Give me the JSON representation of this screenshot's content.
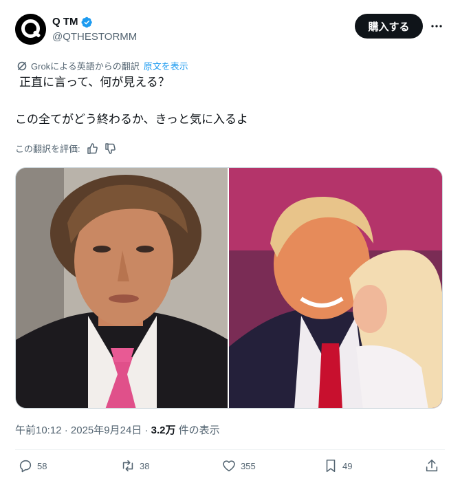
{
  "author": {
    "display_name": "Q TM",
    "handle": "@QTHESTORMM",
    "avatar_letter": "Q",
    "verified": true
  },
  "header": {
    "buy_label": "購入する",
    "more_label": "···"
  },
  "translation": {
    "label": "Grokによる英語からの翻訳",
    "show_original": "原文を表示"
  },
  "tweet": {
    "line1": "正直に言って、何が見える？",
    "line2": "この全てがどう終わるか、きっと気に入るよ"
  },
  "rating": {
    "label": "この翻訳を評価:"
  },
  "meta": {
    "time": "午前10:12",
    "sep1": " · ",
    "date": "2025年9月24日",
    "sep2": " · ",
    "views_count": "3.2万",
    "views_label": " 件の表示"
  },
  "actions": {
    "replies": "58",
    "reposts": "38",
    "likes": "355",
    "bookmarks": "49"
  },
  "colors": {
    "accent": "#1d9bf0",
    "text": "#0f1419",
    "secondary": "#536471"
  }
}
